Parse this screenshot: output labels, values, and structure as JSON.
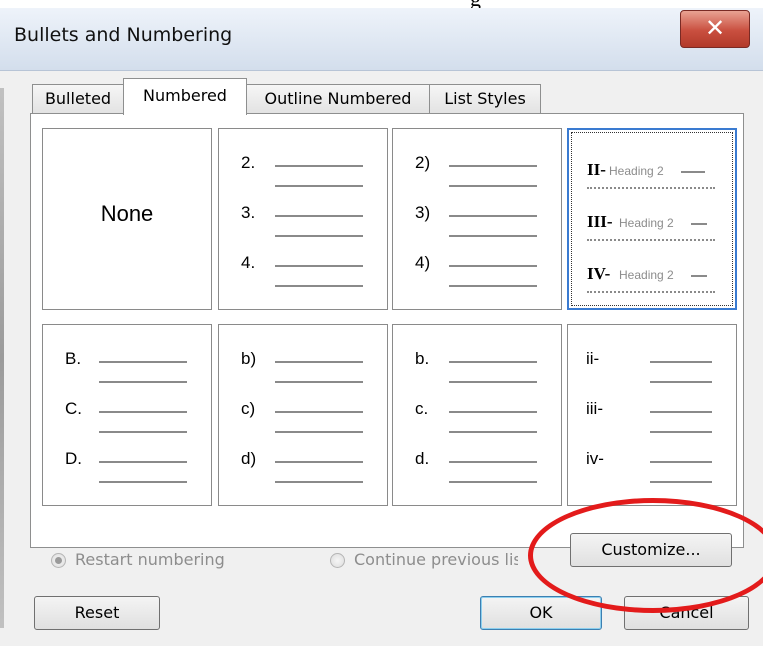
{
  "dialog": {
    "title": "Bullets and Numbering",
    "close_symbol": "✕"
  },
  "tabs": [
    {
      "label": "Bulleted",
      "active": false
    },
    {
      "label": "Numbered",
      "active": true
    },
    {
      "label": "Outline Numbered",
      "active": false
    },
    {
      "label": "List Styles",
      "active": false
    }
  ],
  "gallery": {
    "none_label": "None",
    "row1": {
      "arabic_dot": [
        "2.",
        "3.",
        "4."
      ],
      "arabic_paren": [
        "2)",
        "3)",
        "4)"
      ],
      "roman_heading": {
        "numerals": [
          "II-",
          "III-",
          "IV-"
        ],
        "heading_text": "Heading 2"
      }
    },
    "row2": {
      "upper_alpha_dot": [
        "B.",
        "C.",
        "D."
      ],
      "lower_alpha_paren": [
        "b)",
        "c)",
        "d)"
      ],
      "lower_alpha_dot": [
        "b.",
        "c.",
        "d."
      ],
      "lower_roman_dash": [
        "ii-",
        "iii-",
        "iv-"
      ]
    }
  },
  "options": {
    "restart_numbering": "Restart numbering",
    "continue_previous": "Continue previous list",
    "selected": "restart_numbering"
  },
  "buttons": {
    "customize": "Customize...",
    "reset": "Reset",
    "ok": "OK",
    "cancel": "Cancel"
  },
  "colors": {
    "annotation_ring": "#e31b1b",
    "selection_border": "#3a7bd1",
    "close_button": "#c94f3f"
  }
}
